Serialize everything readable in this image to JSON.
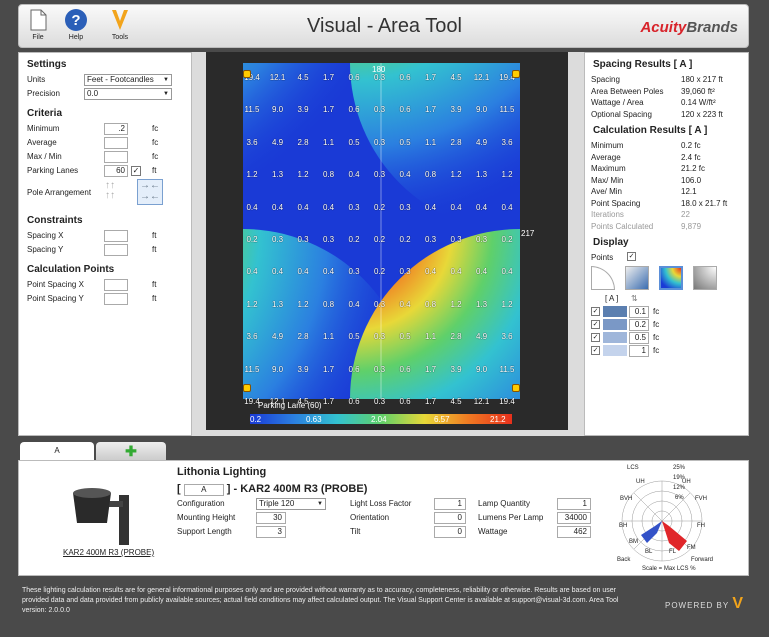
{
  "toolbar": {
    "file": "File",
    "help": "Help",
    "tools": "Tools"
  },
  "app_title": "Visual - Area Tool",
  "brand": {
    "a": "Acuity",
    "b": "Brands"
  },
  "settings": {
    "title": "Settings",
    "units_label": "Units",
    "units_value": "Feet - Footcandles",
    "precision_label": "Precision",
    "precision_value": "0.0"
  },
  "criteria": {
    "title": "Criteria",
    "minimum": "Minimum",
    "minimum_value": ".2",
    "average": "Average",
    "maxmin": "Max / Min",
    "parking": "Parking Lanes",
    "parking_value": "60",
    "pole": "Pole Arrangement",
    "fc": "fc",
    "ft": "ft"
  },
  "constraints": {
    "title": "Constraints",
    "sx": "Spacing X",
    "sy": "Spacing Y",
    "ft": "ft"
  },
  "calcpoints": {
    "title": "Calculation Points",
    "px": "Point Spacing X",
    "py": "Point Spacing Y",
    "ft": "ft"
  },
  "spacing": {
    "title": "Spacing Results  [ A ]",
    "rows": [
      {
        "k": "Spacing",
        "v": "180 x 217 ft"
      },
      {
        "k": "Area Between Poles",
        "v": "39,060 ft²"
      },
      {
        "k": "Wattage / Area",
        "v": "0.14 W/ft²"
      },
      {
        "k": "Optional Spacing",
        "v": "120 x 223 ft"
      }
    ]
  },
  "calc": {
    "title": "Calculation Results  [ A ]",
    "rows": [
      {
        "k": "Minimum",
        "v": "0.2  fc"
      },
      {
        "k": "Average",
        "v": "2.4  fc"
      },
      {
        "k": "Maximum",
        "v": "21.2  fc"
      },
      {
        "k": "Max/ Min",
        "v": "106.0"
      },
      {
        "k": "Ave/ Min",
        "v": "12.1"
      },
      {
        "k": "Point Spacing",
        "v": "18.0 x 21.7 ft"
      }
    ],
    "grey_rows": [
      {
        "k": "Iterations",
        "v": "22"
      },
      {
        "k": "Points Calculated",
        "v": "9,879"
      }
    ]
  },
  "display": {
    "title": "Display",
    "points": "Points",
    "col": "[ A ]",
    "levels": [
      {
        "value": "0.1",
        "unit": "fc",
        "color": "#5b7fb0"
      },
      {
        "value": "0.2",
        "unit": "fc",
        "color": "#7a98c6"
      },
      {
        "value": "0.5",
        "unit": "fc",
        "color": "#9fb6da"
      },
      {
        "value": "1",
        "unit": "fc",
        "color": "#c4d3ec"
      }
    ]
  },
  "plot": {
    "top_label": "180",
    "side_label": "217",
    "lane_label": "Parking Lane (60)",
    "scale": [
      "0.2",
      "0.63",
      "2.04",
      "6.57",
      "21.2"
    ],
    "columns": 11,
    "rows": [
      [
        "19.4",
        "12.1",
        "4.5",
        "1.7",
        "0.6",
        "0.3",
        "0.6",
        "1.7",
        "4.5",
        "12.1",
        "19.4"
      ],
      [
        "11.5",
        "9.0",
        "3.9",
        "1.7",
        "0.6",
        "0.3",
        "0.6",
        "1.7",
        "3.9",
        "9.0",
        "11.5"
      ],
      [
        "3.6",
        "4.9",
        "2.8",
        "1.1",
        "0.5",
        "0.3",
        "0.5",
        "1.1",
        "2.8",
        "4.9",
        "3.6"
      ],
      [
        "1.2",
        "1.3",
        "1.2",
        "0.8",
        "0.4",
        "0.3",
        "0.4",
        "0.8",
        "1.2",
        "1.3",
        "1.2"
      ],
      [
        "0.4",
        "0.4",
        "0.4",
        "0.4",
        "0.3",
        "0.2",
        "0.3",
        "0.4",
        "0.4",
        "0.4",
        "0.4"
      ],
      [
        "0.2",
        "0.3",
        "0.3",
        "0.3",
        "0.2",
        "0.2",
        "0.2",
        "0.3",
        "0.3",
        "0.3",
        "0.2"
      ],
      [
        "0.4",
        "0.4",
        "0.4",
        "0.4",
        "0.3",
        "0.2",
        "0.3",
        "0.4",
        "0.4",
        "0.4",
        "0.4"
      ],
      [
        "1.2",
        "1.3",
        "1.2",
        "0.8",
        "0.4",
        "0.3",
        "0.4",
        "0.8",
        "1.2",
        "1.3",
        "1.2"
      ],
      [
        "3.6",
        "4.9",
        "2.8",
        "1.1",
        "0.5",
        "0.3",
        "0.5",
        "1.1",
        "2.8",
        "4.9",
        "3.6"
      ],
      [
        "11.5",
        "9.0",
        "3.9",
        "1.7",
        "0.6",
        "0.3",
        "0.6",
        "1.7",
        "3.9",
        "9.0",
        "11.5"
      ],
      [
        "19.4",
        "12.1",
        "4.5",
        "1.7",
        "0.6",
        "0.3",
        "0.6",
        "1.7",
        "4.5",
        "12.1",
        "19.4"
      ]
    ]
  },
  "tabs": {
    "a": "A",
    "add": "✚"
  },
  "product": {
    "brand": "Lithonia Lighting",
    "tag": "A",
    "name": "- KAR2 400M R3 (PROBE)",
    "link": "KAR2 400M R3 (PROBE)",
    "config_label": "Configuration",
    "config_value": "Triple 120",
    "mh_label": "Mounting Height",
    "mh_value": "30",
    "sl_label": "Support Length",
    "sl_value": "3",
    "llf_label": "Light Loss Factor",
    "llf_value": "1",
    "orient_label": "Orientation",
    "orient_value": "0",
    "tilt_label": "Tilt",
    "tilt_value": "0",
    "lq_label": "Lamp Quantity",
    "lq_value": "1",
    "lpl_label": "Lumens Per Lamp",
    "lpl_value": "34000",
    "watt_label": "Wattage",
    "watt_value": "462"
  },
  "polar": {
    "rings": [
      "25%",
      "19%",
      "12%",
      "6%"
    ],
    "labels": {
      "lcs": "LCS",
      "uh": "UH",
      "uh2": "UH",
      "fvh": "FVH",
      "bvh": "BVH",
      "fh": "FH",
      "bh": "BH",
      "fm": "FM",
      "bm": "BM",
      "fl": "FL",
      "bl": "BL",
      "back": "Back",
      "forward": "Forward",
      "scale": "Scale = Max LCS %"
    }
  },
  "footer": {
    "disclaimer": "These lighting calculation results are for general informational purposes only and are provided without warranty as to accuracy, completeness, reliability or otherwise. Results are based on user provided data and data provided from publicly available sources; actual field conditions may affect calculated output. The Visual Support Center is available at support@visual-3d.com. Area Tool version: 2.0.0.0",
    "powered": "POWERED BY"
  }
}
